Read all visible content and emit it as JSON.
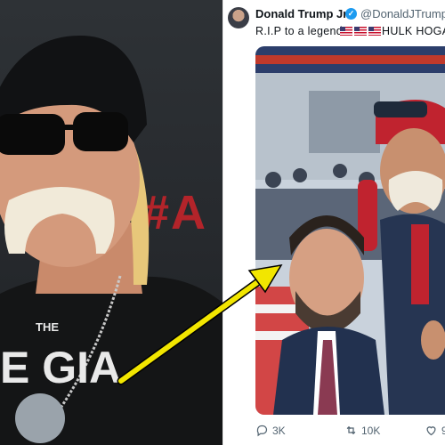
{
  "left_photo": {
    "backdrop_text": "#A"
  },
  "tweet": {
    "author_name": "Donald Trump Jr.",
    "author_handle": "@DonaldJTrumpJ",
    "text_before_flags": "R.I.P to a legend.",
    "flags": [
      "us-flag",
      "us-flag",
      "us-flag"
    ],
    "text_after_flags": "HULK HOGA",
    "actions": {
      "replies": "3K",
      "reposts": "10K",
      "likes": "9"
    }
  },
  "colors": {
    "verified_blue": "#1d9bf0",
    "arrow_yellow": "#f2e600",
    "text_primary": "#0f1419",
    "text_secondary": "#536471"
  }
}
